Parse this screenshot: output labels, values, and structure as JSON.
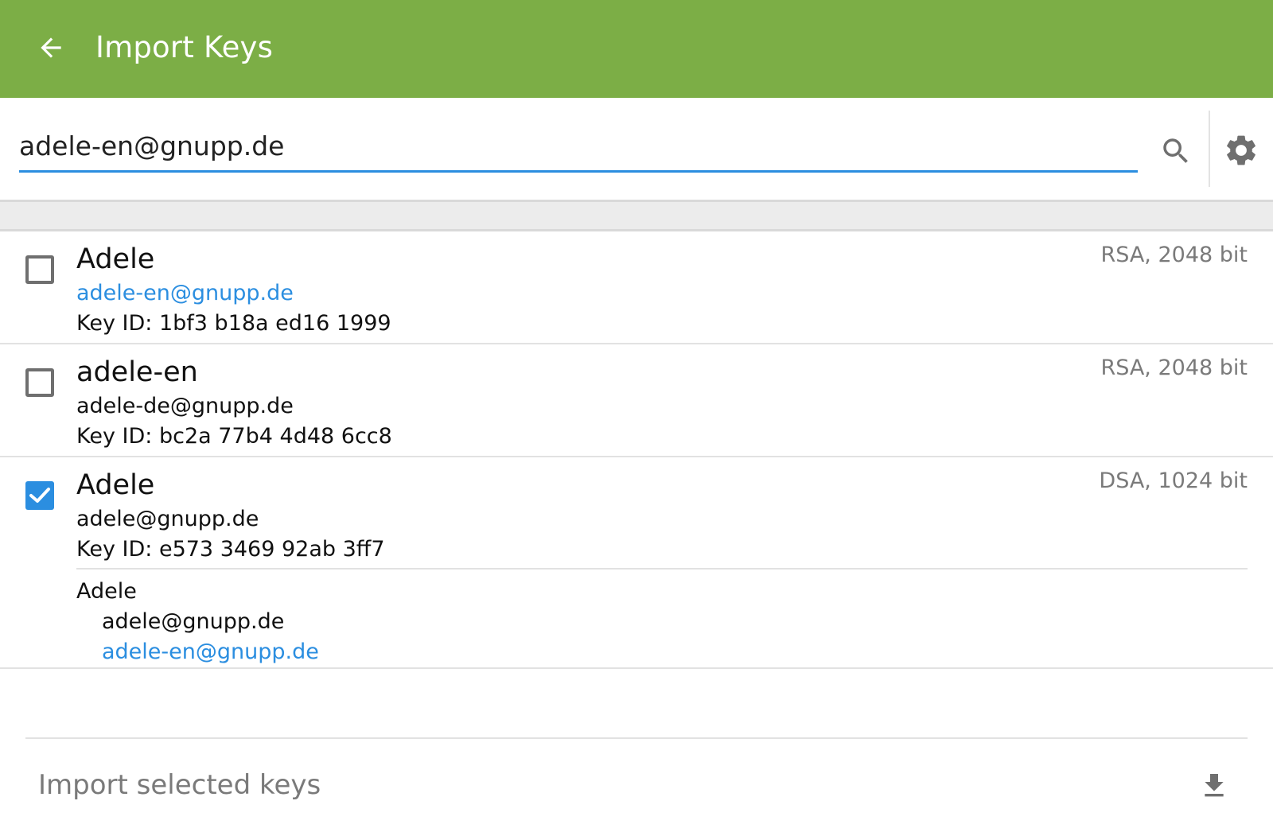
{
  "app_bar": {
    "title": "Import Keys",
    "background": "#7cae46",
    "back_icon": "arrow-left-icon"
  },
  "search": {
    "value": "adele-en@gnupp.de",
    "search_icon": "search-icon",
    "settings_icon": "gear-icon",
    "accent": "#2b8ee0"
  },
  "keys": [
    {
      "name": "Adele",
      "email": "adele-en@gnupp.de",
      "email_highlighted": true,
      "key_id": "Key ID: 1bf3 b18a ed16 1999",
      "algorithm": "RSA, 2048 bit",
      "checked": false
    },
    {
      "name": "adele-en",
      "email": "adele-de@gnupp.de",
      "email_highlighted": false,
      "key_id": "Key ID: bc2a 77b4 4d48 6cc8",
      "algorithm": "RSA, 2048 bit",
      "checked": false
    },
    {
      "name": "Adele",
      "email": "adele@gnupp.de",
      "email_highlighted": false,
      "key_id": "Key ID: e573 3469 92ab 3ff7",
      "algorithm": "DSA, 1024 bit",
      "checked": true,
      "user_ids": {
        "name": "Adele",
        "emails": [
          "adele@gnupp.de",
          "adele-en@gnupp.de"
        ]
      }
    }
  ],
  "footer": {
    "import_label": "Import selected keys",
    "import_icon": "download-icon"
  }
}
